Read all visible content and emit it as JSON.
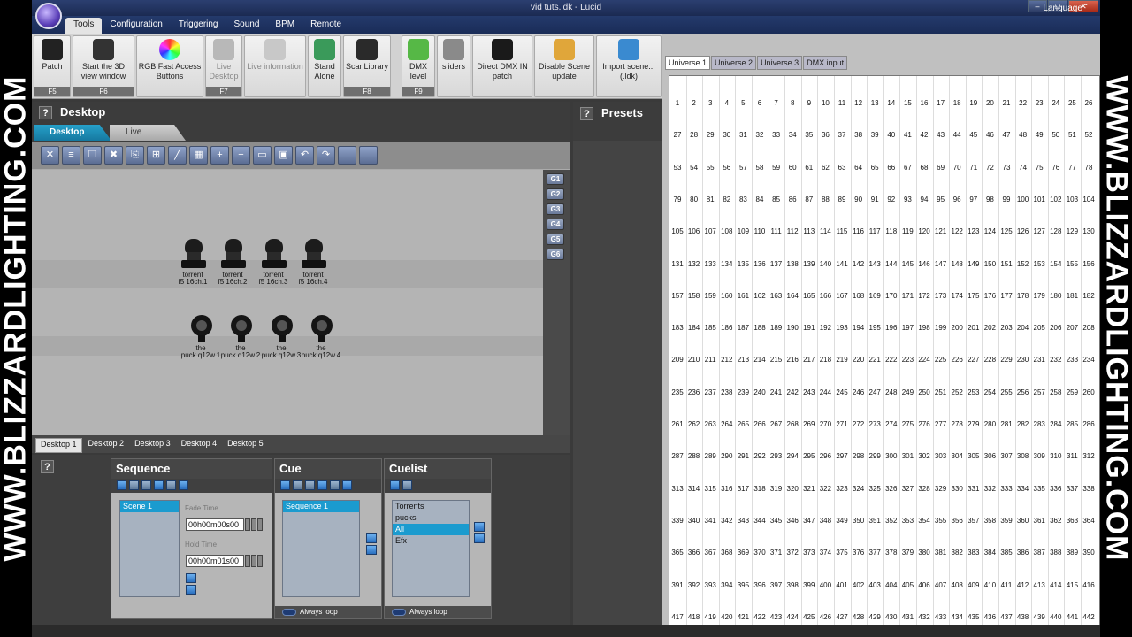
{
  "watermark": {
    "text": "WWW.BLIZZARDLIGHTING.COM"
  },
  "window": {
    "title": "vid tuts.ldk - Lucid",
    "min": "–",
    "max": "□",
    "close": "✕"
  },
  "menu": {
    "tabs": [
      "Tools",
      "Configuration",
      "Triggering",
      "Sound",
      "BPM",
      "Remote"
    ],
    "active": "Tools",
    "language": "Language ˇ"
  },
  "ribbon": {
    "buttons": [
      {
        "label": "Patch",
        "key": "F5",
        "icon": "patch-icon",
        "color": "#222222"
      },
      {
        "label": "Start the 3D view window",
        "key": "F6",
        "icon": "3d-view-icon",
        "color": "#333333"
      },
      {
        "label": "RGB Fast Access Buttons",
        "key": "",
        "icon": "rgb-wheel-icon",
        "color": "#e24dd1"
      },
      {
        "label": "Live Desktop",
        "key": "F7",
        "icon": "live-desktop-icon",
        "color": "#b8b8b8"
      },
      {
        "label": "Live information",
        "key": "",
        "icon": "info-icon",
        "color": "#c8c8c8"
      },
      {
        "label": "Stand Alone",
        "key": "",
        "icon": "stand-alone-icon",
        "color": "#3a9a5a"
      },
      {
        "label": "ScanLibrary",
        "key": "F8",
        "icon": "scan-library-icon",
        "color": "#2a2a2a"
      },
      {
        "label": "DMX level",
        "key": "F9",
        "icon": "dmx-level-icon",
        "color": "#56b846"
      },
      {
        "label": "sliders",
        "key": "",
        "icon": "sliders-icon",
        "color": "#8a8a8a"
      },
      {
        "label": "Direct DMX IN patch",
        "key": "",
        "icon": "dmx-in-icon",
        "color": "#1a1a1a"
      },
      {
        "label": "Disable Scene update",
        "key": "",
        "icon": "lock-icon",
        "color": "#e0a63a"
      },
      {
        "label": "Import scene... (.ldk)",
        "key": "",
        "icon": "import-icon",
        "color": "#3a8ad0"
      }
    ]
  },
  "desktop": {
    "title": "Desktop",
    "help": "?",
    "tabs": [
      "Desktop",
      "Live"
    ],
    "groups": [
      "G1",
      "G2",
      "G3",
      "G4",
      "G5",
      "G6"
    ],
    "fixtures_moving": [
      {
        "line1": "torrent",
        "line2": "f5 16ch.1"
      },
      {
        "line1": "torrent",
        "line2": "f5 16ch.2"
      },
      {
        "line1": "torrent",
        "line2": "f5 16ch.3"
      },
      {
        "line1": "torrent",
        "line2": "f5 16ch.4"
      }
    ],
    "fixtures_par": [
      {
        "line1": "the",
        "line2": "puck q12w.1"
      },
      {
        "line1": "the",
        "line2": "puck q12w.2"
      },
      {
        "line1": "the",
        "line2": "puck q12w.3"
      },
      {
        "line1": "the",
        "line2": "puck q12w.4"
      }
    ],
    "pages": [
      "Desktop 1",
      "Desktop 2",
      "Desktop 3",
      "Desktop 4",
      "Desktop 5"
    ],
    "active_page": "Desktop 1"
  },
  "presets": {
    "title": "Presets",
    "help": "?"
  },
  "universe": {
    "tabs": [
      "Universe 1",
      "Universe 2",
      "Universe 3",
      "DMX input"
    ],
    "active": "Universe 1",
    "first_channel": 1,
    "per_row": 26,
    "rows": 18
  },
  "sequence": {
    "title": "Sequence",
    "items": [
      "Scene 1"
    ],
    "fade_label": "Fade Time",
    "fade_value": "00h00m00s00",
    "hold_label": "Hold Time",
    "hold_value": "00h00m01s00"
  },
  "cue": {
    "title": "Cue",
    "items": [
      "Sequence 1"
    ],
    "loop": "Always loop"
  },
  "cuelist": {
    "title": "Cuelist",
    "items": [
      "Torrents",
      "pucks",
      "All",
      "Efx"
    ],
    "selected": "All",
    "loop": "Always loop"
  },
  "bottom_help": "?"
}
